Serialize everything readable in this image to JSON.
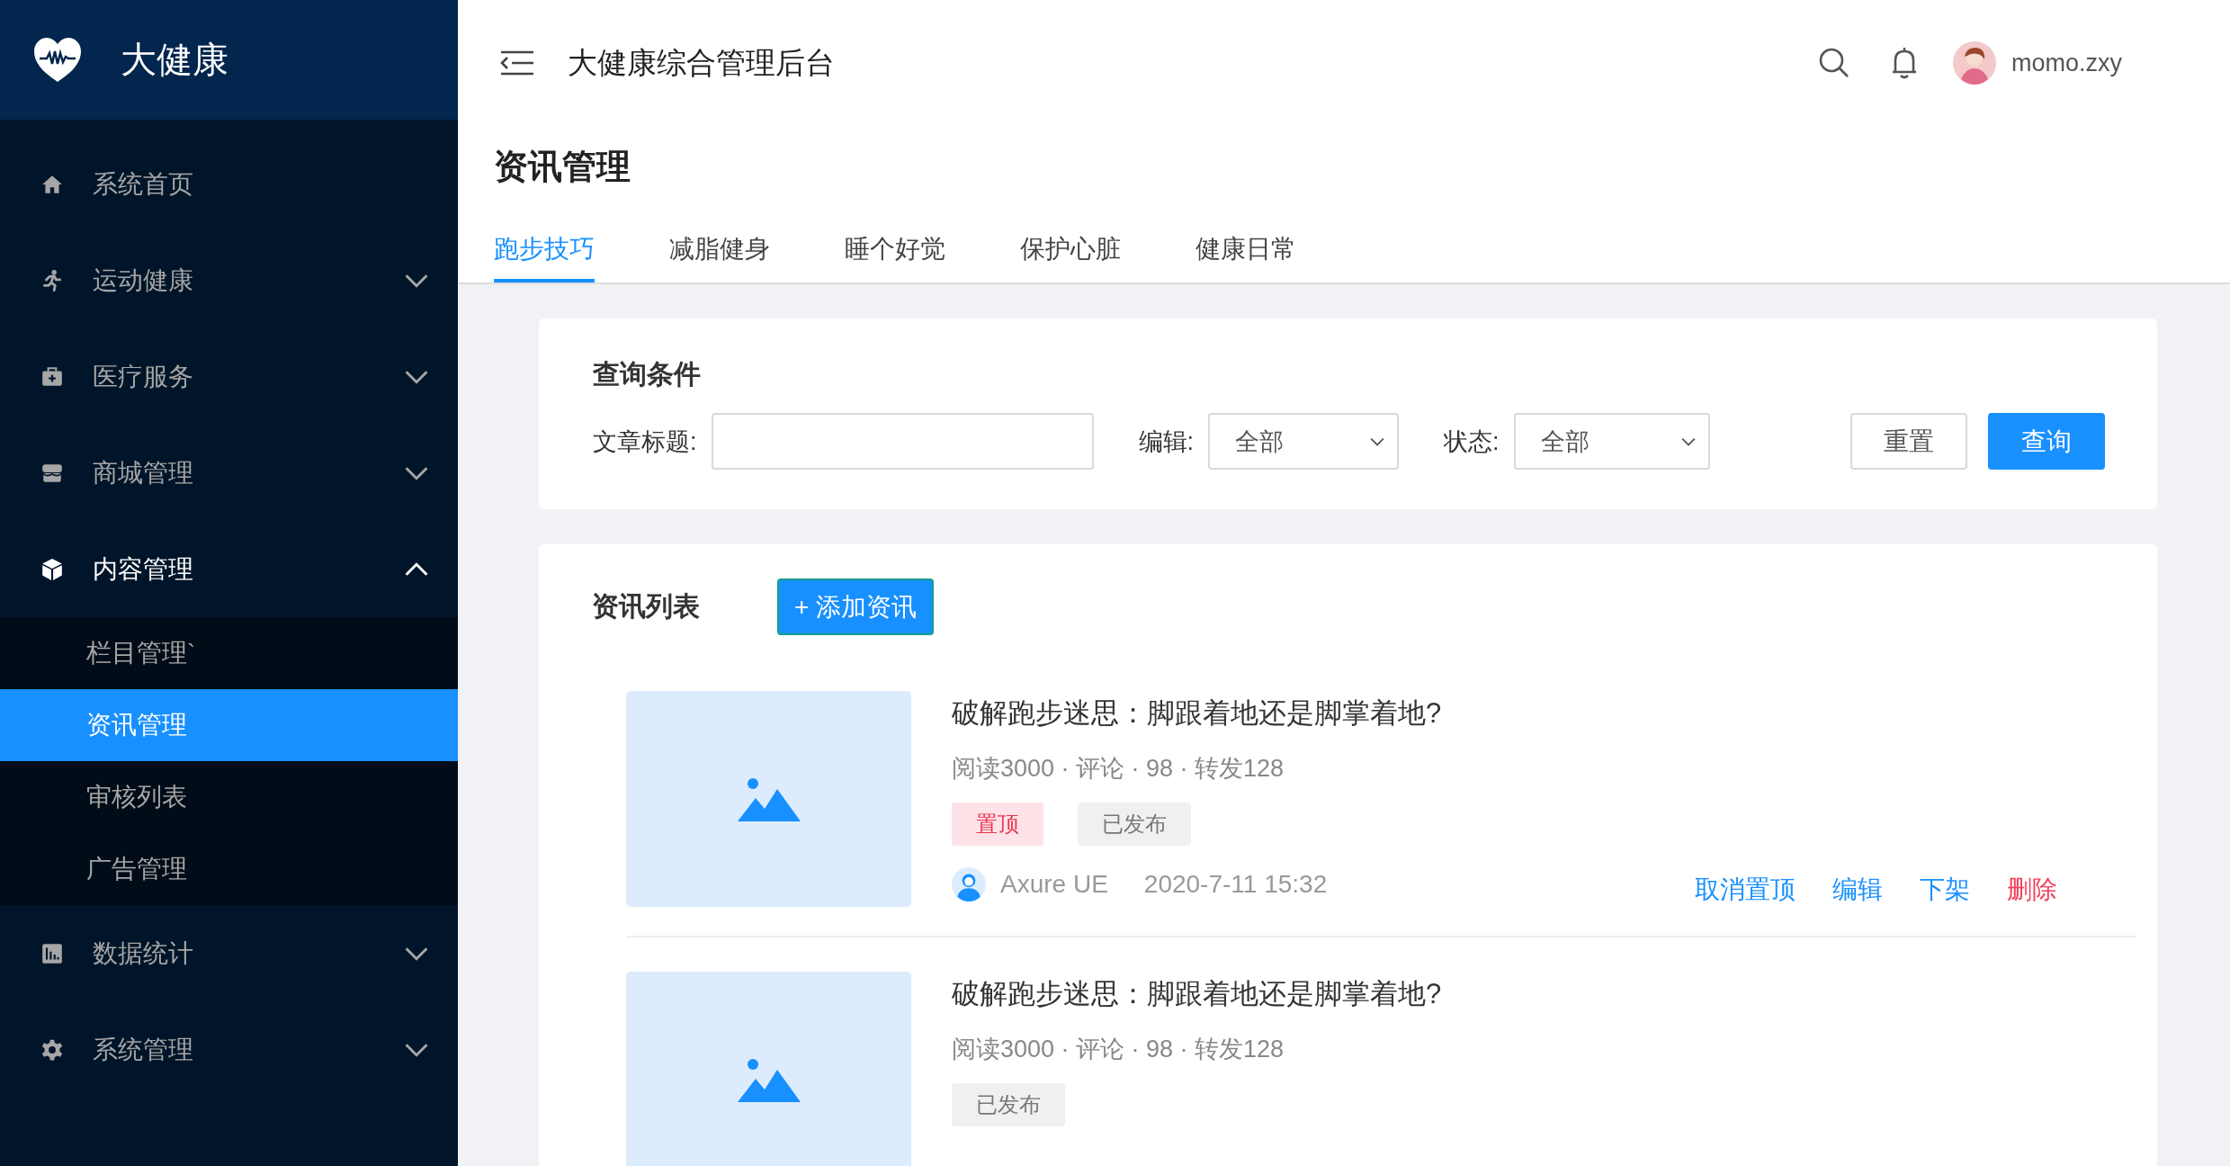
{
  "sidebar": {
    "logo": "大健康",
    "items": [
      {
        "label": "系统首页"
      },
      {
        "label": "运动健康",
        "expanded": false
      },
      {
        "label": "医疗服务",
        "expanded": false
      },
      {
        "label": "商城管理",
        "expanded": false
      },
      {
        "label": "内容管理",
        "expanded": true,
        "children": [
          {
            "label": "栏目管理`",
            "selected": false
          },
          {
            "label": "资讯管理",
            "selected": true
          },
          {
            "label": "审核列表",
            "selected": false
          },
          {
            "label": "广告管理",
            "selected": false
          }
        ]
      },
      {
        "label": "数据统计",
        "expanded": false
      },
      {
        "label": "系统管理",
        "expanded": false
      }
    ]
  },
  "header": {
    "title": "大健康综合管理后台",
    "user": "momo.zxy"
  },
  "page_title": "资讯管理",
  "tabs": [
    {
      "label": "跑步技巧",
      "selected": true
    },
    {
      "label": "减脂健身",
      "selected": false
    },
    {
      "label": "睡个好觉",
      "selected": false
    },
    {
      "label": "保护心脏",
      "selected": false
    },
    {
      "label": "健康日常",
      "selected": false
    }
  ],
  "query": {
    "title": "查询条件",
    "title_label": "文章标题:",
    "editor_label": "编辑:",
    "editor_value": "全部",
    "status_label": "状态:",
    "status_value": "全部",
    "reset": "重置",
    "search": "查询"
  },
  "list": {
    "title": "资讯列表",
    "add_button": "+ 添加资讯",
    "articles": [
      {
        "title": "破解跑步迷思：脚跟着地还是脚掌着地?",
        "stats": "阅读3000 · 评论 · 98 · 转发128",
        "tags": [
          {
            "label": "置顶",
            "kind": "pinned"
          },
          {
            "label": "已发布",
            "kind": "published"
          }
        ],
        "author": "Axure UE",
        "time": "2020-7-11 15:32",
        "actions": [
          {
            "label": "取消置顶",
            "kind": "normal"
          },
          {
            "label": "编辑",
            "kind": "normal"
          },
          {
            "label": "下架",
            "kind": "normal"
          },
          {
            "label": "删除",
            "kind": "danger"
          }
        ]
      },
      {
        "title": "破解跑步迷思：脚跟着地还是脚掌着地?",
        "stats": "阅读3000 · 评论 · 98 · 转发128",
        "tags": [
          {
            "label": "已发布",
            "kind": "published"
          }
        ]
      }
    ]
  }
}
